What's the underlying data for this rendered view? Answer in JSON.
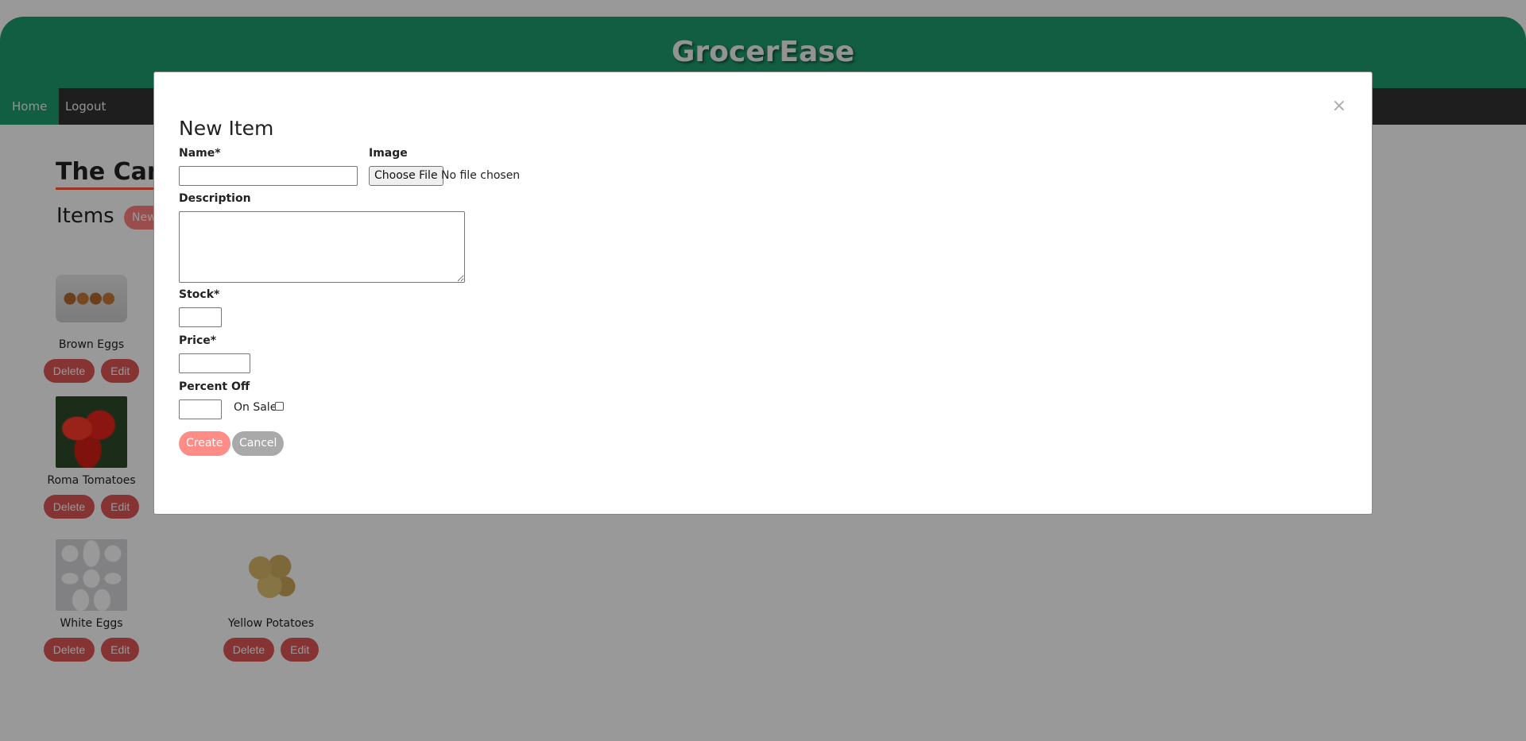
{
  "app": {
    "title": "GrocerEase"
  },
  "nav": {
    "home": "Home",
    "logout": "Logout"
  },
  "store": {
    "name": "The Cana"
  },
  "items_section": {
    "title": "Items",
    "new_button": "New"
  },
  "items": [
    {
      "name": "Brown Eggs",
      "delete": "Delete",
      "edit": "Edit"
    },
    {
      "name": "Roma Tomatoes",
      "delete": "Delete",
      "edit": "Edit"
    },
    {
      "name": "White Eggs",
      "delete": "Delete",
      "edit": "Edit"
    },
    {
      "name": "Yellow Potatoes",
      "delete": "Delete",
      "edit": "Edit"
    }
  ],
  "modal": {
    "title": "New Item",
    "close": "×",
    "fields": {
      "name_label": "Name*",
      "name_value": "",
      "image_label": "Image",
      "file_button": "Choose File",
      "file_status": "No file chosen",
      "description_label": "Description",
      "description_value": "",
      "stock_label": "Stock*",
      "stock_value": "",
      "price_label": "Price*",
      "price_value": "",
      "percent_off_label": "Percent Off",
      "percent_off_value": "",
      "on_sale_label": "On Sale"
    },
    "create_button": "Create",
    "cancel_button": "Cancel"
  },
  "colors": {
    "header": "#1f9d6e",
    "nav": "#333333",
    "accent_button": "#e05555",
    "create_button": "#ff8c86",
    "cancel_button": "#a9a9a9"
  }
}
